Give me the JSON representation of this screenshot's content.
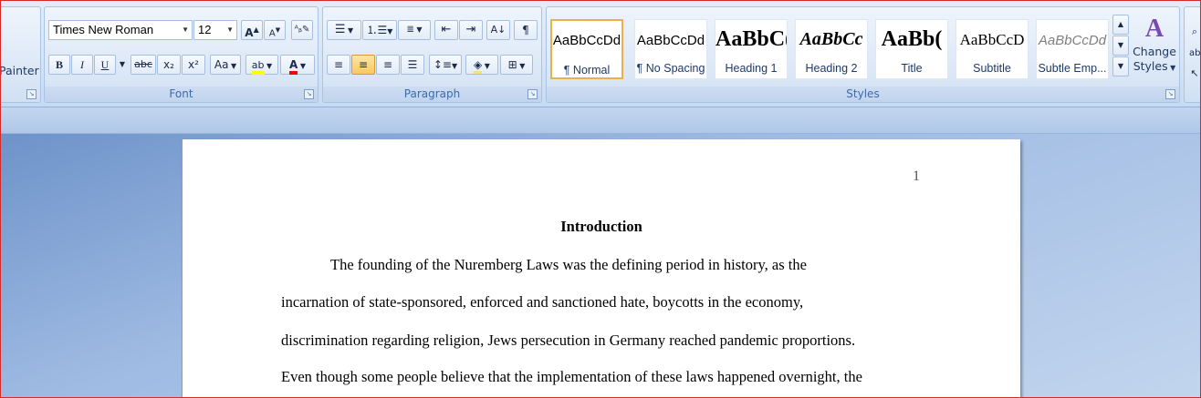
{
  "clipboard": {
    "painter_label": "Painter"
  },
  "font": {
    "name": "Times New Roman",
    "size": "12",
    "grow_label": "A",
    "shrink_label": "A",
    "bold": "B",
    "italic": "I",
    "underline": "U",
    "strike": "abc",
    "subscript": "x₂",
    "superscript": "x²",
    "change_case": "Aa",
    "highlight": "ab",
    "font_color": "A",
    "caption": "Font"
  },
  "paragraph": {
    "caption": "Paragraph",
    "show_marks": "¶"
  },
  "styles": {
    "caption": "Styles",
    "tiles": [
      {
        "sample": "AaBbCcDd",
        "name": "¶ Normal"
      },
      {
        "sample": "AaBbCcDd",
        "name": "¶ No Spacing"
      },
      {
        "sample": "AaBbC(",
        "name": "Heading 1"
      },
      {
        "sample": "AaBbCc",
        "name": "Heading 2"
      },
      {
        "sample": "AaBb(",
        "name": "Title"
      },
      {
        "sample": "AaBbCcD",
        "name": "Subtitle"
      },
      {
        "sample": "AaBbCcDd",
        "name": "Subtle Emp..."
      }
    ],
    "change_styles_line1": "Change",
    "change_styles_line2": "Styles"
  },
  "document": {
    "page_number": "1",
    "heading": "Introduction",
    "lines": [
      "The founding of the Nuremberg Laws was the defining period in history, as the",
      "incarnation of state-sponsored, enforced and sanctioned hate, boycotts in the economy,",
      "discrimination regarding religion, Jews persecution in Germany reached pandemic proportions.",
      "Even though some people believe that the implementation of these laws happened overnight, the"
    ]
  },
  "colors": {
    "highlight": "#ffff00",
    "font_color": "#ff0000",
    "selected_style_border": "#e8b14a"
  }
}
